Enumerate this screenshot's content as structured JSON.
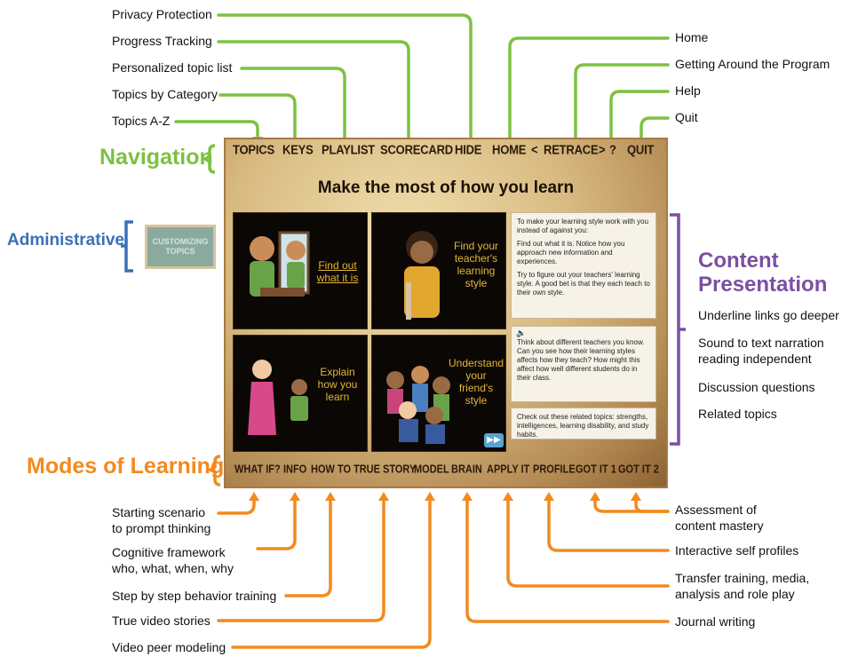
{
  "sections": {
    "navigation": "Navigation",
    "modes": "Modes of Learning",
    "administrative": "Administrative",
    "content": "Content Presentation"
  },
  "colors": {
    "navigation": "#7dc142",
    "modes": "#f28a1e",
    "administrative": "#3b6fb6",
    "content": "#7b4fa3"
  },
  "nav_labels": {
    "privacy": "Privacy Protection",
    "progress": "Progress Tracking",
    "personalized": "Personalized topic list",
    "category": "Topics by Category",
    "az": "Topics A-Z",
    "home": "Home",
    "getting_around": "Getting Around the Program",
    "help": "Help",
    "quit": "Quit"
  },
  "content_labels": {
    "underline": "Underline links go deeper",
    "sound": "Sound to text narration reading independent",
    "sound_l1": "Sound to text narration",
    "sound_l2": "reading independent",
    "discussion": "Discussion questions",
    "related": "Related topics"
  },
  "mode_labels": {
    "starting_l1": "Starting scenario",
    "starting_l2": "to prompt thinking",
    "cognitive_l1": "Cognitive framework",
    "cognitive_l2": "who, what, when, why",
    "step": "Step by step behavior training",
    "true_video": "True video stories",
    "peer": "Video peer modeling",
    "assess_l1": "Assessment of",
    "assess_l2": "content mastery",
    "self_profiles": "Interactive self profiles",
    "transfer_l1": "Transfer training, media,",
    "transfer_l2": "analysis and role play",
    "journal": "Journal writing"
  },
  "app": {
    "title": "Make the most of how you learn",
    "nav": {
      "topics": "TOPICS",
      "keys": "KEYS",
      "playlist": "PLAYLIST",
      "scorecard": "SCORECARD",
      "hide": "HIDE",
      "home": "HOME",
      "lt": "<",
      "retrace": "RETRACE",
      "gt": ">",
      "help": "?",
      "quit": "QUIT"
    },
    "modes": {
      "whatif": "WHAT IF?",
      "info": "INFO",
      "howto": "HOW TO",
      "truestory": "TRUE STORY",
      "model": "MODEL",
      "brain": "BRAIN",
      "applyit": "APPLY IT",
      "profile": "PROFILE",
      "gotit1": "GOT IT 1",
      "gotit2": "GOT IT 2"
    },
    "admin_button": "CUSTOMIZING TOPICS",
    "panels": {
      "p1": "Find out what it is",
      "p2": "Find your teacher's learning style",
      "p3": "Explain how you learn",
      "p4": "Understand your friend's style"
    },
    "text1": {
      "a": "To make your learning style work with you instead of against you:",
      "b": "Find out what it is. Notice how you approach new information and experiences.",
      "c": "Try to figure out your teachers' learning style. A good bet is that they each teach to their own style."
    },
    "text2": "Think about different teachers you know. Can you see how their learning styles affects how they teach? How might this affect how well different students do in their class.",
    "text3": "Check out these related topics: strengths, intelligences, learning disability, and study habits."
  }
}
